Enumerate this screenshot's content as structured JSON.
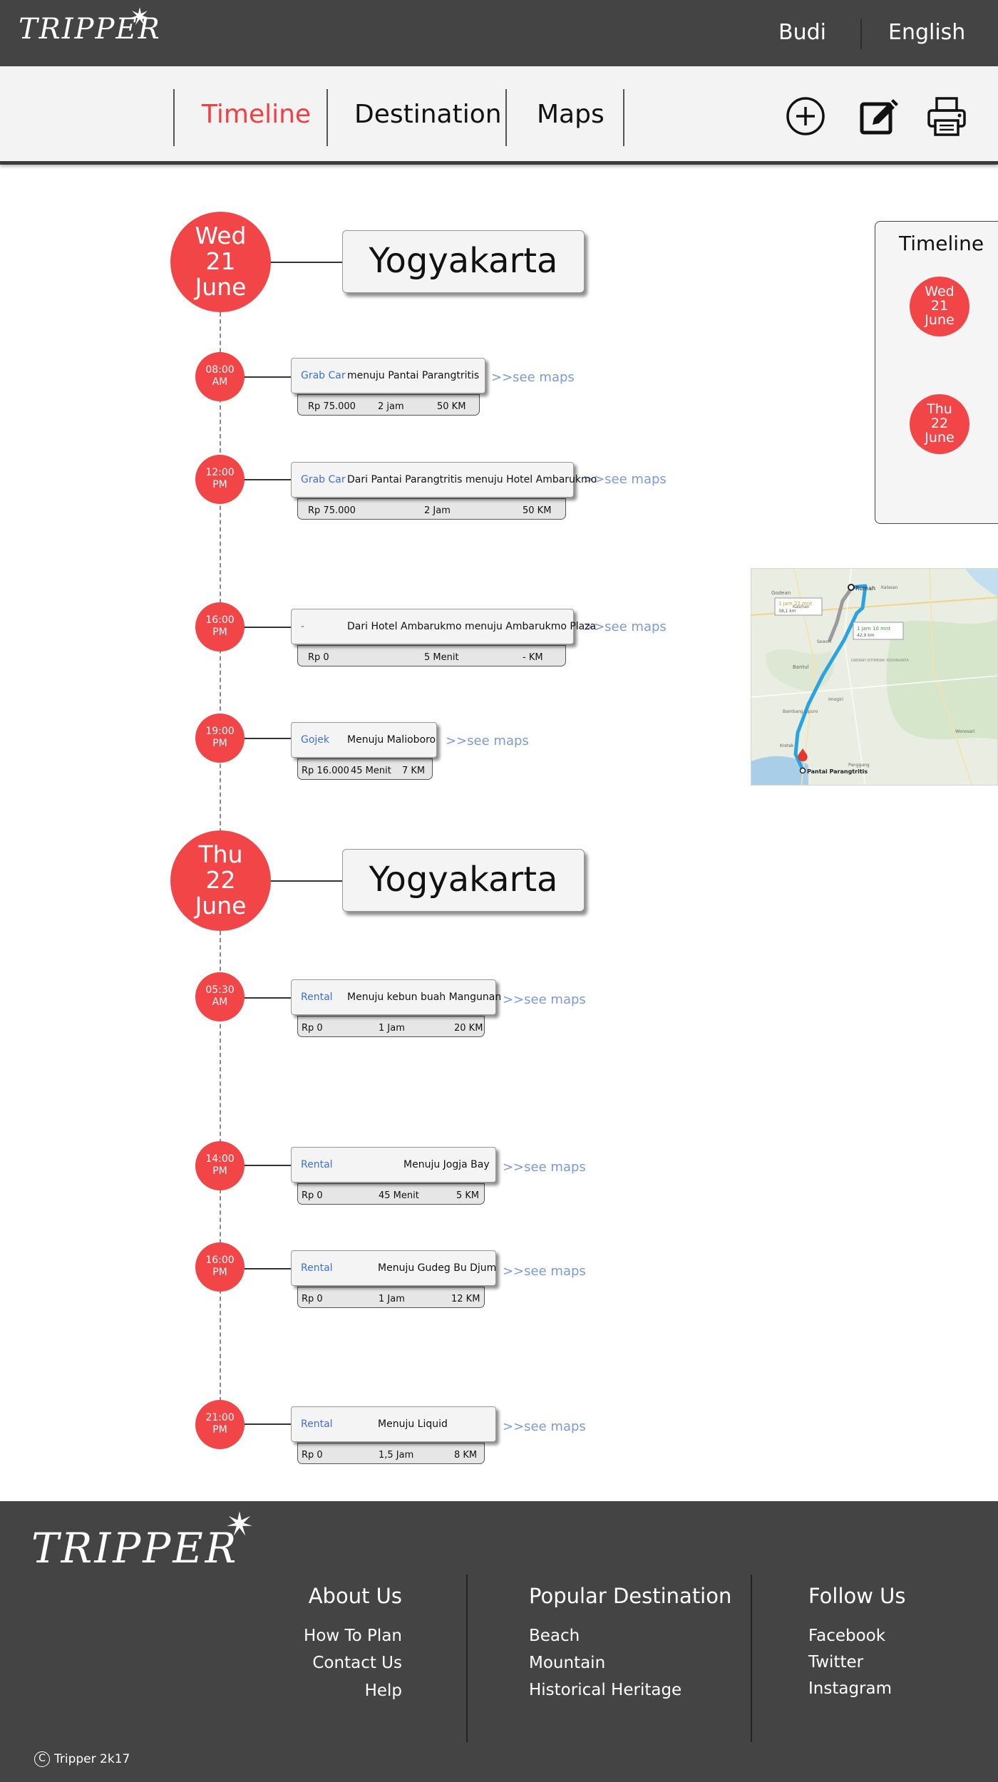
{
  "topbar": {
    "logo": "TRIPPER",
    "user": "Budi",
    "language": "English"
  },
  "nav": {
    "tabs": [
      "Timeline",
      "Destination",
      "Maps"
    ],
    "active_tab": "Timeline",
    "icons": [
      "add-icon",
      "edit-icon",
      "print-icon"
    ]
  },
  "days": [
    {
      "weekday": "Wed",
      "date": "21",
      "month": "June",
      "city": "Yogyakarta",
      "trips": [
        {
          "time": "08:00",
          "ampm": "AM",
          "vehicle": "Grab Car",
          "desc": "menuju Pantai Parangtritis",
          "price": "Rp 75.000",
          "duration": "2 jam",
          "distance": "50 KM",
          "see_maps": ">>see maps"
        },
        {
          "time": "12:00",
          "ampm": "PM",
          "vehicle": "Grab Car",
          "desc": "Dari Pantai Parangtritis menuju Hotel Ambarukmo",
          "price": "Rp 75.000",
          "duration": "2 Jam",
          "distance": "50 KM",
          "see_maps": ">>see maps"
        },
        {
          "time": "16:00",
          "ampm": "PM",
          "vehicle": "-",
          "desc": "Dari Hotel Ambarukmo menuju Ambarukmo Plaza",
          "price": "Rp 0",
          "duration": "5 Menit",
          "distance": "- KM",
          "see_maps": ">>see maps"
        },
        {
          "time": "19:00",
          "ampm": "PM",
          "vehicle": "Gojek",
          "desc": "Menuju Malioboro",
          "price": "Rp 16.000",
          "duration": "45 Menit",
          "distance": "7 KM",
          "see_maps": ">>see maps"
        }
      ]
    },
    {
      "weekday": "Thu",
      "date": "22",
      "month": "June",
      "city": "Yogyakarta",
      "trips": [
        {
          "time": "05:30",
          "ampm": "AM",
          "vehicle": "Rental",
          "desc": "Menuju kebun buah Mangunan",
          "price": "Rp 0",
          "duration": "1 Jam",
          "distance": "20 KM",
          "see_maps": ">>see maps"
        },
        {
          "time": "14:00",
          "ampm": "PM",
          "vehicle": "Rental",
          "desc": "Menuju Jogja Bay",
          "price": "Rp 0",
          "duration": "45 Menit",
          "distance": "5 KM",
          "see_maps": ">>see maps"
        },
        {
          "time": "16:00",
          "ampm": "PM",
          "vehicle": "Rental",
          "desc": "Menuju Gudeg Bu Djum",
          "price": "Rp 0",
          "duration": "1 Jam",
          "distance": "12 KM",
          "see_maps": ">>see maps"
        },
        {
          "time": "21:00",
          "ampm": "PM",
          "vehicle": "Rental",
          "desc": "Menuju Liquid",
          "price": "Rp 0",
          "duration": "1,5 Jam",
          "distance": "8 KM",
          "see_maps": ">>see maps"
        }
      ]
    }
  ],
  "side_panel": {
    "title": "Timeline",
    "days": [
      {
        "weekday": "Wed",
        "date": "21",
        "month": "June"
      },
      {
        "weekday": "Thu",
        "date": "22",
        "month": "June"
      }
    ]
  },
  "map": {
    "route_primary": "1 jam 10 mnt",
    "route_primary_km": "42,9 km",
    "route_alt": "1 jam 22 mnt",
    "route_alt_km": "38,1 km",
    "start_label": "Rumah",
    "end_label": "Pantai Parangtritis",
    "places": [
      "Godean",
      "Kalasan",
      "Kasihan",
      "Sewon",
      "Bantul",
      "Imogiri",
      "Bambang Lipuro",
      "Kretek",
      "Panggang",
      "Wonosari"
    ],
    "area_label": "DAERAH ISTIMEWA YOGYAKARTA",
    "colors": {
      "route": "#2aa3e0",
      "alt_route": "#9b9b9b",
      "pin": "#e2372f"
    }
  },
  "footer": {
    "logo": "TRIPPER",
    "columns": [
      {
        "heading": "About Us",
        "links": [
          "How To Plan",
          "Contact Us",
          "Help"
        ]
      },
      {
        "heading": "Popular Destination",
        "links": [
          "Beach",
          "Mountain",
          "Historical Heritage"
        ]
      },
      {
        "heading": "Follow Us",
        "links": [
          "Facebook",
          "Twitter",
          "Instagram"
        ]
      }
    ],
    "copyright_symbol": "C",
    "copyright": "Tripper 2k17"
  },
  "colors": {
    "accent": "#f24547",
    "vehicle_text": "#3d6fe0",
    "see_maps": "#7d9ad8",
    "dark_bar": "#444444"
  }
}
